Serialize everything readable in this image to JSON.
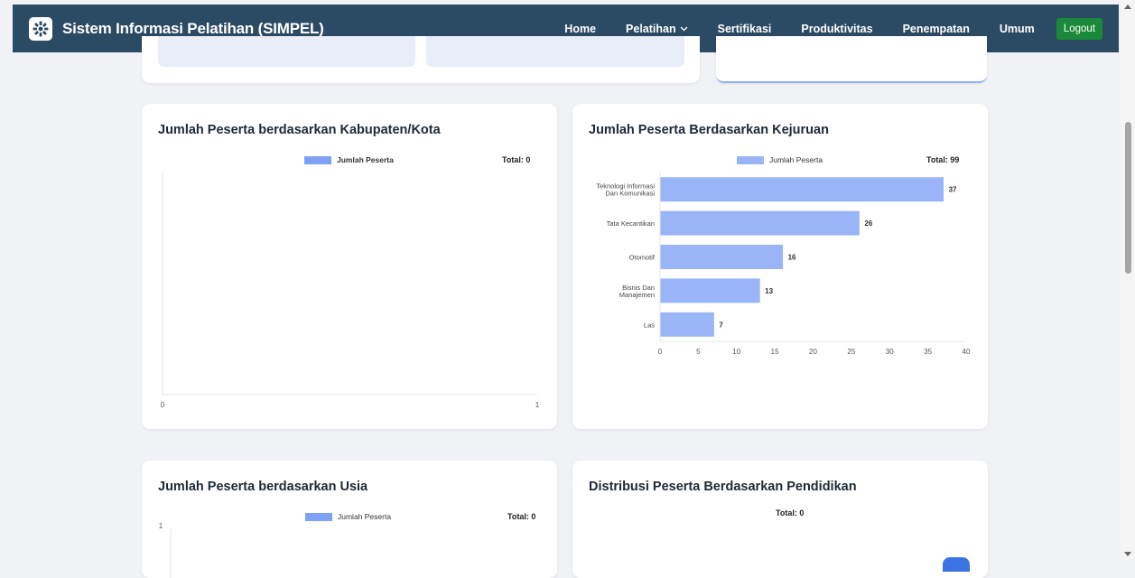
{
  "navbar": {
    "title": "Sistem Informasi Pelatihan (SIMPEL)",
    "items": [
      {
        "label": "Home"
      },
      {
        "label": "Pelatihan",
        "has_dropdown": true
      },
      {
        "label": "Sertifikasi"
      },
      {
        "label": "Produktivitas"
      },
      {
        "label": "Penempatan"
      },
      {
        "label": "Umum"
      }
    ],
    "logout_label": "Logout"
  },
  "cards": {
    "kabupaten": {
      "title": "Jumlah Peserta berdasarkan Kabupaten/Kota",
      "legend": "Jumlah Peserta",
      "total": "Total: 0"
    },
    "kejuruan": {
      "title": "Jumlah Peserta Berdasarkan Kejuruan",
      "legend": "Jumlah Peserta",
      "total": "Total: 99"
    },
    "usia": {
      "title": "Jumlah Peserta berdasarkan Usia",
      "legend": "Jumlah Peserta",
      "total": "Total: 0"
    },
    "pendidikan": {
      "title": "Distribusi Peserta Berdasarkan Pendidikan",
      "total": "Total: 0"
    }
  },
  "colors": {
    "navbar": "#2b4a64",
    "bar": "#9ab5f7",
    "legend": "#7ea1f5",
    "logout": "#1a8a3a"
  },
  "chart_data": [
    {
      "type": "bar",
      "orientation": "vertical",
      "categories": [],
      "series": [
        {
          "name": "Jumlah Peserta",
          "values": []
        }
      ],
      "xticks": [
        "0",
        "1"
      ],
      "xlim": [
        0,
        1
      ]
    },
    {
      "type": "bar",
      "orientation": "horizontal",
      "categories": [
        [
          "Teknologi Informasi",
          "Dan Komunikasi"
        ],
        [
          "Tata Kecantikan"
        ],
        [
          "Otomotif"
        ],
        [
          "Bisnis Dan",
          "Manajemen"
        ],
        [
          "Las"
        ]
      ],
      "series": [
        {
          "name": "Jumlah Peserta",
          "values": [
            37,
            26,
            16,
            13,
            7
          ]
        }
      ],
      "xlim": [
        0,
        40
      ],
      "xticks": [
        0,
        5,
        10,
        15,
        20,
        25,
        30,
        35,
        40
      ],
      "data_labels": true
    },
    {
      "type": "bar",
      "categories": [],
      "series": [
        {
          "name": "Jumlah Peserta",
          "values": []
        }
      ],
      "yticks": [
        "1"
      ]
    }
  ]
}
